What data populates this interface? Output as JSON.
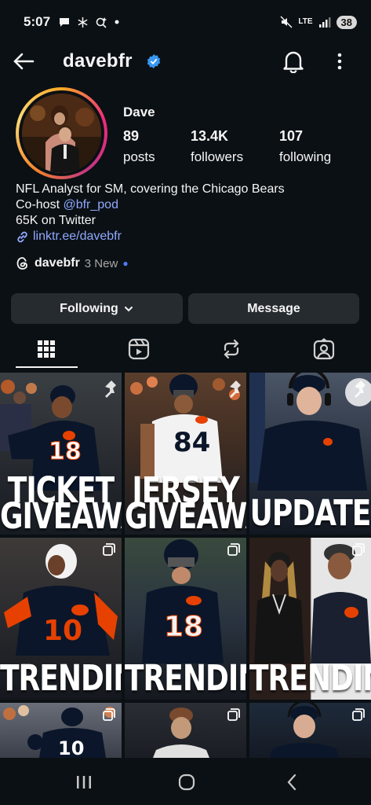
{
  "status_bar": {
    "time": "5:07",
    "left_icons": [
      "chat-bubble-icon",
      "snowflake-icon",
      "assistant-icon",
      "dot-icon"
    ],
    "right_icons": [
      "mute-icon",
      "lte-icon",
      "signal-icon"
    ],
    "lte_label": "LTE",
    "battery": "38"
  },
  "header": {
    "username": "davebfr",
    "verified": true,
    "accent": "#3897f0"
  },
  "profile": {
    "display_name": "Dave",
    "stats": [
      {
        "value": "89",
        "label": "posts"
      },
      {
        "value": "13.4K",
        "label": "followers"
      },
      {
        "value": "107",
        "label": "following"
      }
    ],
    "bio": {
      "line1": "NFL Analyst for SM, covering the Chicago Bears",
      "line2_prefix": "Co-host ",
      "line2_mention": "@bfr_pod",
      "line3": "65K on Twitter",
      "link": "linktr.ee/davebfr"
    },
    "threads": {
      "name": "davebfr",
      "badge": "3 New"
    }
  },
  "actions": {
    "following_label": "Following",
    "message_label": "Message"
  },
  "tabs": [
    {
      "name": "grid-icon",
      "active": true
    },
    {
      "name": "reels-icon",
      "active": false
    },
    {
      "name": "reposts-icon",
      "active": false
    },
    {
      "name": "tagged-icon",
      "active": false
    }
  ],
  "grid": [
    {
      "caption_line1": "TICKET",
      "caption_line2": "GIVEAWAY",
      "icon": "pin-icon"
    },
    {
      "caption_line1": "JERSEY",
      "caption_line2": "GIVEAWAY",
      "jersey_number": "84",
      "icon": "pin-icon"
    },
    {
      "caption_line1": "UPDATE",
      "icon": "pin-icon"
    },
    {
      "caption_line1": "TRENDING",
      "jersey_number": "10",
      "icon": "carousel-icon"
    },
    {
      "caption_line1": "TRENDING",
      "jersey_number": "18",
      "icon": "carousel-icon"
    },
    {
      "caption_line1": "TRENDING",
      "icon": "carousel-icon"
    },
    {
      "jersey_number": "10",
      "icon": "carousel-icon"
    },
    {
      "icon": "carousel-icon"
    },
    {
      "icon": "carousel-icon"
    }
  ],
  "nav": [
    "recents-icon",
    "home-icon",
    "back-icon"
  ],
  "colors": {
    "background": "#0b1014",
    "button": "#262b30",
    "link": "#8fa8ff",
    "bears_navy": "#0b162a",
    "bears_orange": "#e64100"
  }
}
